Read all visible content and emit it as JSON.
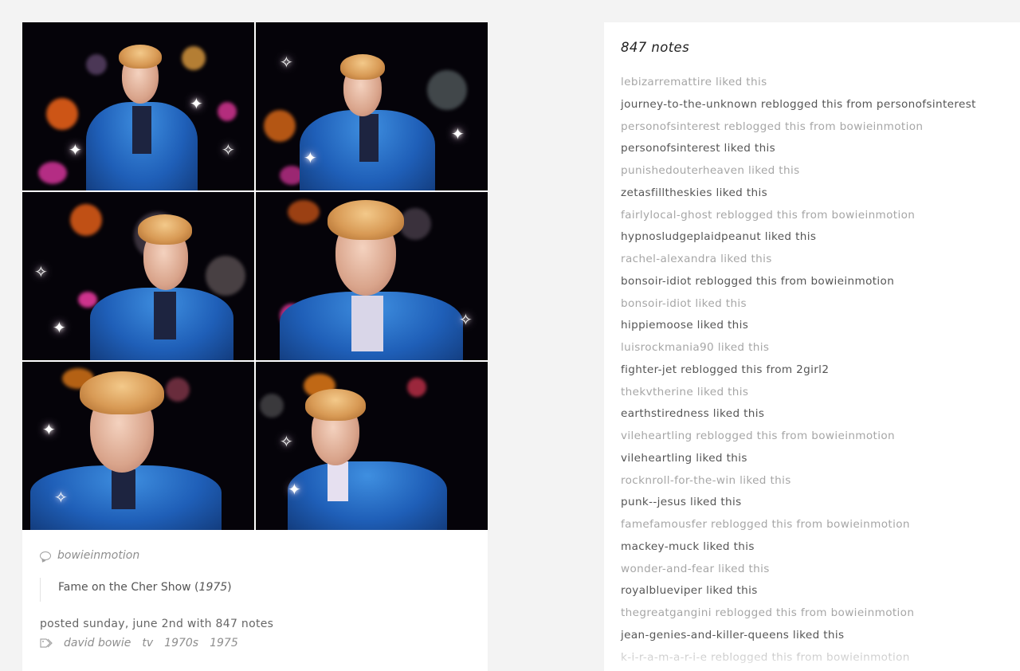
{
  "post": {
    "source": "bowieinmotion",
    "caption": {
      "text": "Fame on the Cher Show (",
      "year": "1975",
      "close": ")"
    },
    "posted": "posted sunday, june 2nd with 847 notes",
    "tags": [
      "david bowie",
      "tv",
      "1970s",
      "1975"
    ]
  },
  "notes": {
    "title": "847 notes",
    "items": [
      "lebizarremattire liked this",
      "journey-to-the-unknown reblogged this from personofsinterest",
      "personofsinterest reblogged this from bowieinmotion",
      "personofsinterest liked this",
      "punishedouterheaven liked this",
      "zetasfilltheskies liked this",
      "fairlylocal-ghost reblogged this from bowieinmotion",
      "hypnosludgeplaidpeanut liked this",
      "rachel-alexandra liked this",
      "bonsoir-idiot reblogged this from bowieinmotion",
      "bonsoir-idiot liked this",
      "hippiemoose liked this",
      "luisrockmania90 liked this",
      "fighter-jet reblogged this from 2girl2",
      "thekvtherine liked this",
      "earthstiredness liked this",
      "vileheartling reblogged this from bowieinmotion",
      "vileheartling liked this",
      "rocknroll-for-the-win liked this",
      "punk--jesus liked this",
      "famefamousfer reblogged this from bowieinmotion",
      "mackey-muck liked this",
      "wonder-and-fear liked this",
      "royalblueviper liked this",
      "thegreatgangini reblogged this from bowieinmotion",
      "jean-genies-and-killer-queens liked this",
      "k-i-r-a-m-a-r-i-e reblogged this from bowieinmotion"
    ]
  }
}
